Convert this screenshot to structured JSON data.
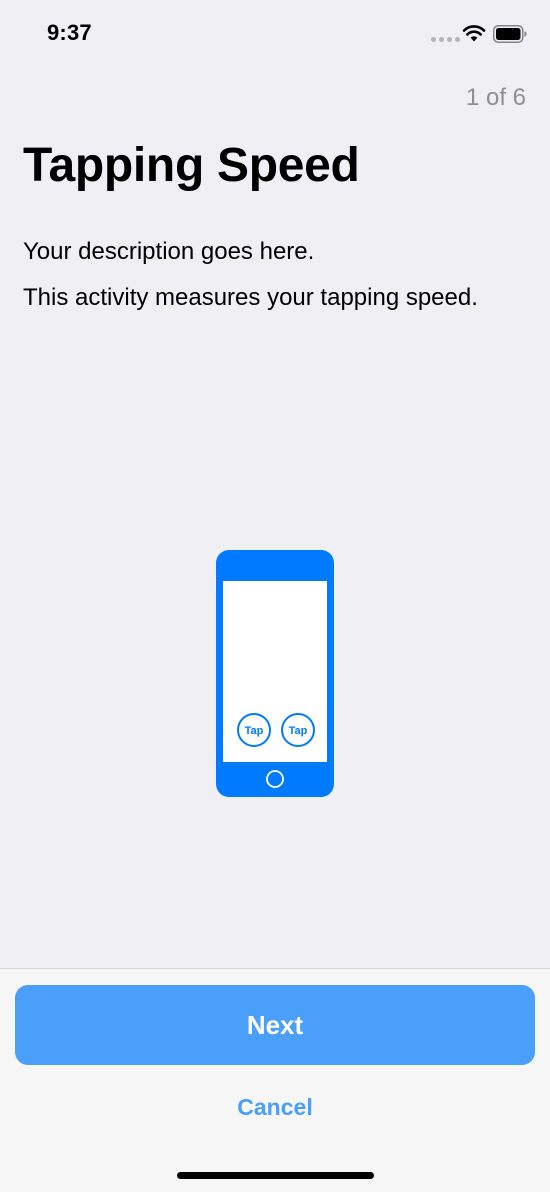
{
  "status_bar": {
    "time": "9:37",
    "icons": [
      "cellular-signal-icon",
      "wifi-icon",
      "battery-icon"
    ]
  },
  "step_indicator": "1 of 6",
  "title": "Tapping Speed",
  "description": [
    "Your description goes here.",
    "This activity measures your tapping speed."
  ],
  "illustration": {
    "icon": "phone-tapping-illustration",
    "tap_labels": [
      "Tap",
      "Tap"
    ],
    "color": "#007aff"
  },
  "buttons": {
    "next": "Next",
    "cancel": "Cancel"
  },
  "colors": {
    "accent": "#4a9ffb",
    "background": "#efeff4"
  }
}
